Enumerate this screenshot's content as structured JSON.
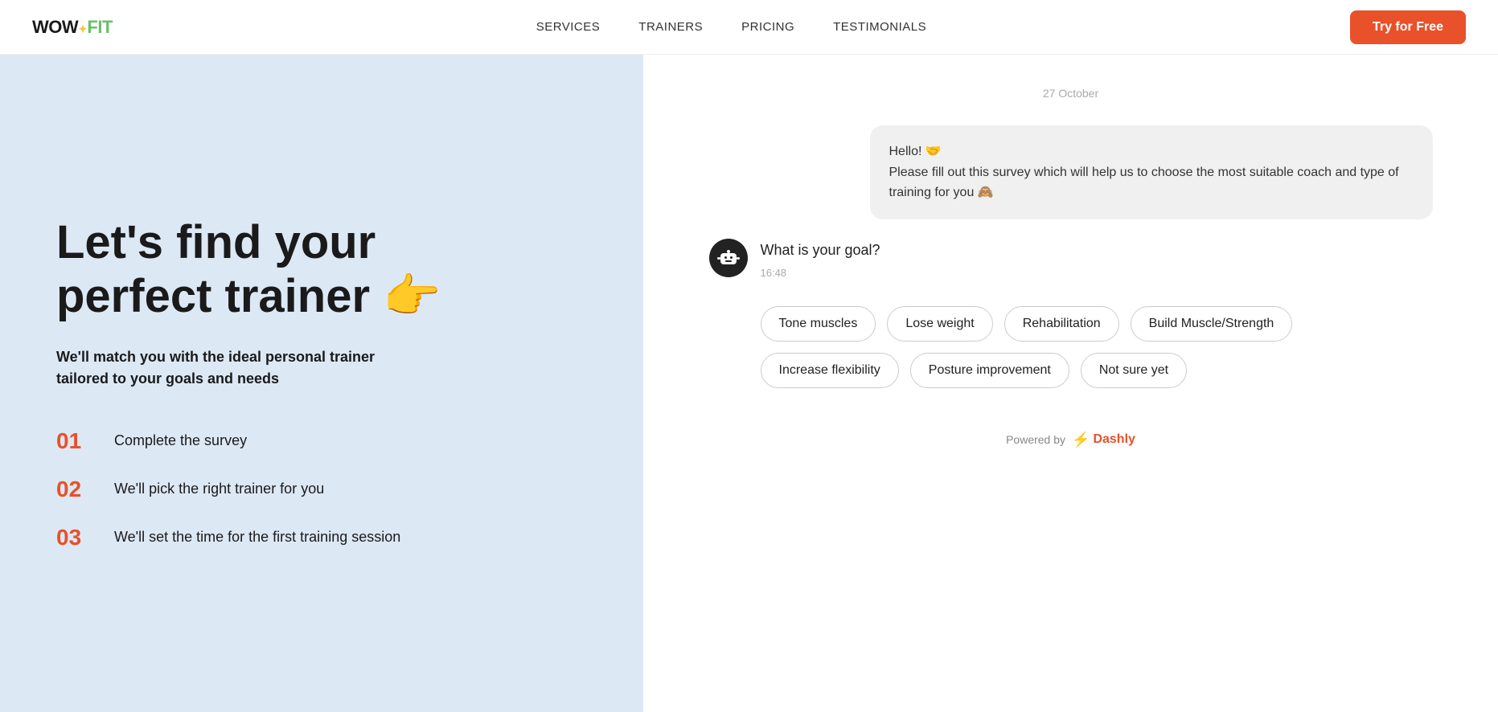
{
  "navbar": {
    "logo": "WOW",
    "logo_fit": "FIT",
    "links": [
      "SERVICES",
      "TRAINERS",
      "PRICING",
      "TESTIMONIALS"
    ],
    "cta_label": "Try for Free"
  },
  "left": {
    "title_line1": "Let's find your",
    "title_line2": "perfect trainer",
    "title_emoji": "👉",
    "subtitle": "We'll match you with the ideal personal trainer tailored to your goals and needs",
    "steps": [
      {
        "number": "01",
        "text": "Complete the survey"
      },
      {
        "number": "02",
        "text": "We'll pick the right trainer for you"
      },
      {
        "number": "03",
        "text": "We'll set the time for the first training session"
      }
    ]
  },
  "chat": {
    "date_label": "27 October",
    "bot_greeting": "Hello! 🤝\nPlease fill out this survey which will help us to choose the most suitable coach and type of training for you 🙈",
    "bot_question": "What is your goal?",
    "bot_time": "16:48",
    "goal_options": [
      "Tone muscles",
      "Lose weight",
      "Rehabilitation",
      "Build Muscle/Strength",
      "Increase flexibility",
      "Posture improvement",
      "Not sure yet"
    ]
  },
  "footer": {
    "powered_by": "Powered by",
    "brand": "Dashly"
  }
}
